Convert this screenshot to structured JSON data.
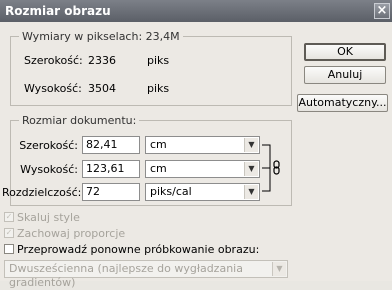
{
  "title": "Rozmiar obrazu",
  "close_glyph": "×",
  "pixels": {
    "legend": "Wymiary w pikselach: 23,4M",
    "width_label": "Szerokość:",
    "width_value": "2336",
    "width_unit": "piks",
    "height_label": "Wysokość:",
    "height_value": "3504",
    "height_unit": "piks"
  },
  "document": {
    "legend": "Rozmiar dokumentu:",
    "width_label": "Szerokość:",
    "width_value": "82,41",
    "width_unit": "cm",
    "height_label": "Wysokość:",
    "height_value": "123,61",
    "height_unit": "cm",
    "resolution_label": "Rozdzielczość:",
    "resolution_value": "72",
    "resolution_unit": "piks/cal"
  },
  "buttons": {
    "ok": "OK",
    "cancel": "Anuluj",
    "auto": "Automatyczny..."
  },
  "options": {
    "scale_styles": {
      "label": "Skaluj style",
      "checked": true,
      "enabled": false
    },
    "constrain": {
      "label": "Zachowaj proporcje",
      "checked": true,
      "enabled": false
    },
    "resample": {
      "label": "Przeprowadź ponowne próbkowanie obrazu:",
      "checked": false,
      "enabled": true
    },
    "resample_method": "Dwusześcienna (najlepsze do wygładzania gradientów)"
  },
  "icons": {
    "dropdown": "chevron-down-icon",
    "link": "chain-link-icon",
    "checkmark": "checkmark-icon"
  },
  "colors": {
    "titlebar": "#6a6e76",
    "dialog": "#ece9e4"
  }
}
